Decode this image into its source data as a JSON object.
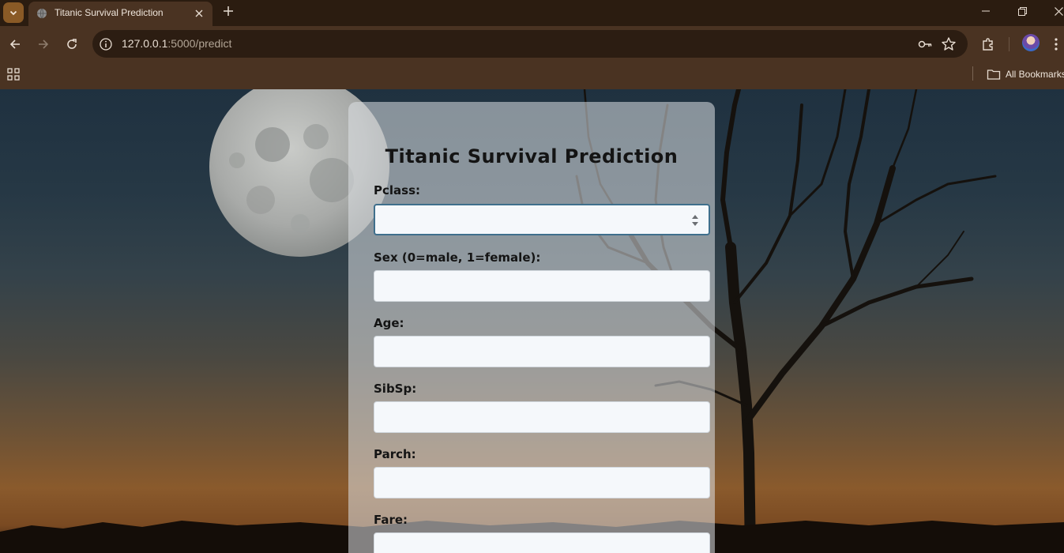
{
  "browser": {
    "tab_title": "Titanic Survival Prediction",
    "url_host": "127.0.0.1",
    "url_path": ":5000/predict",
    "bookmarks_label": "All Bookmarks"
  },
  "form": {
    "title": "Titanic Survival Prediction",
    "fields": [
      {
        "label": "Pclass:",
        "value": "",
        "type": "number"
      },
      {
        "label": "Sex (0=male, 1=female):",
        "value": "",
        "type": "number"
      },
      {
        "label": "Age:",
        "value": "",
        "type": "number"
      },
      {
        "label": "SibSp:",
        "value": "",
        "type": "number"
      },
      {
        "label": "Parch:",
        "value": "",
        "type": "number"
      },
      {
        "label": "Fare:",
        "value": "",
        "type": "number"
      }
    ]
  },
  "icons": {
    "tab_search": "chevron-down-icon",
    "favicon": "globe-icon",
    "close": "close-icon",
    "new_tab": "plus-icon",
    "back": "arrow-left-icon",
    "forward": "arrow-right-icon",
    "reload": "reload-icon",
    "site_info": "info-icon",
    "password": "key-icon",
    "bookmark": "star-icon",
    "extensions": "puzzle-icon",
    "apps": "grid-icon",
    "folder": "folder-icon"
  },
  "colors": {
    "chrome_dark": "#2b1c10",
    "chrome": "#4a3322",
    "tab_menu": "#8a5a26",
    "card": "#dee2e6",
    "focus_border": "#3f6f8c"
  }
}
